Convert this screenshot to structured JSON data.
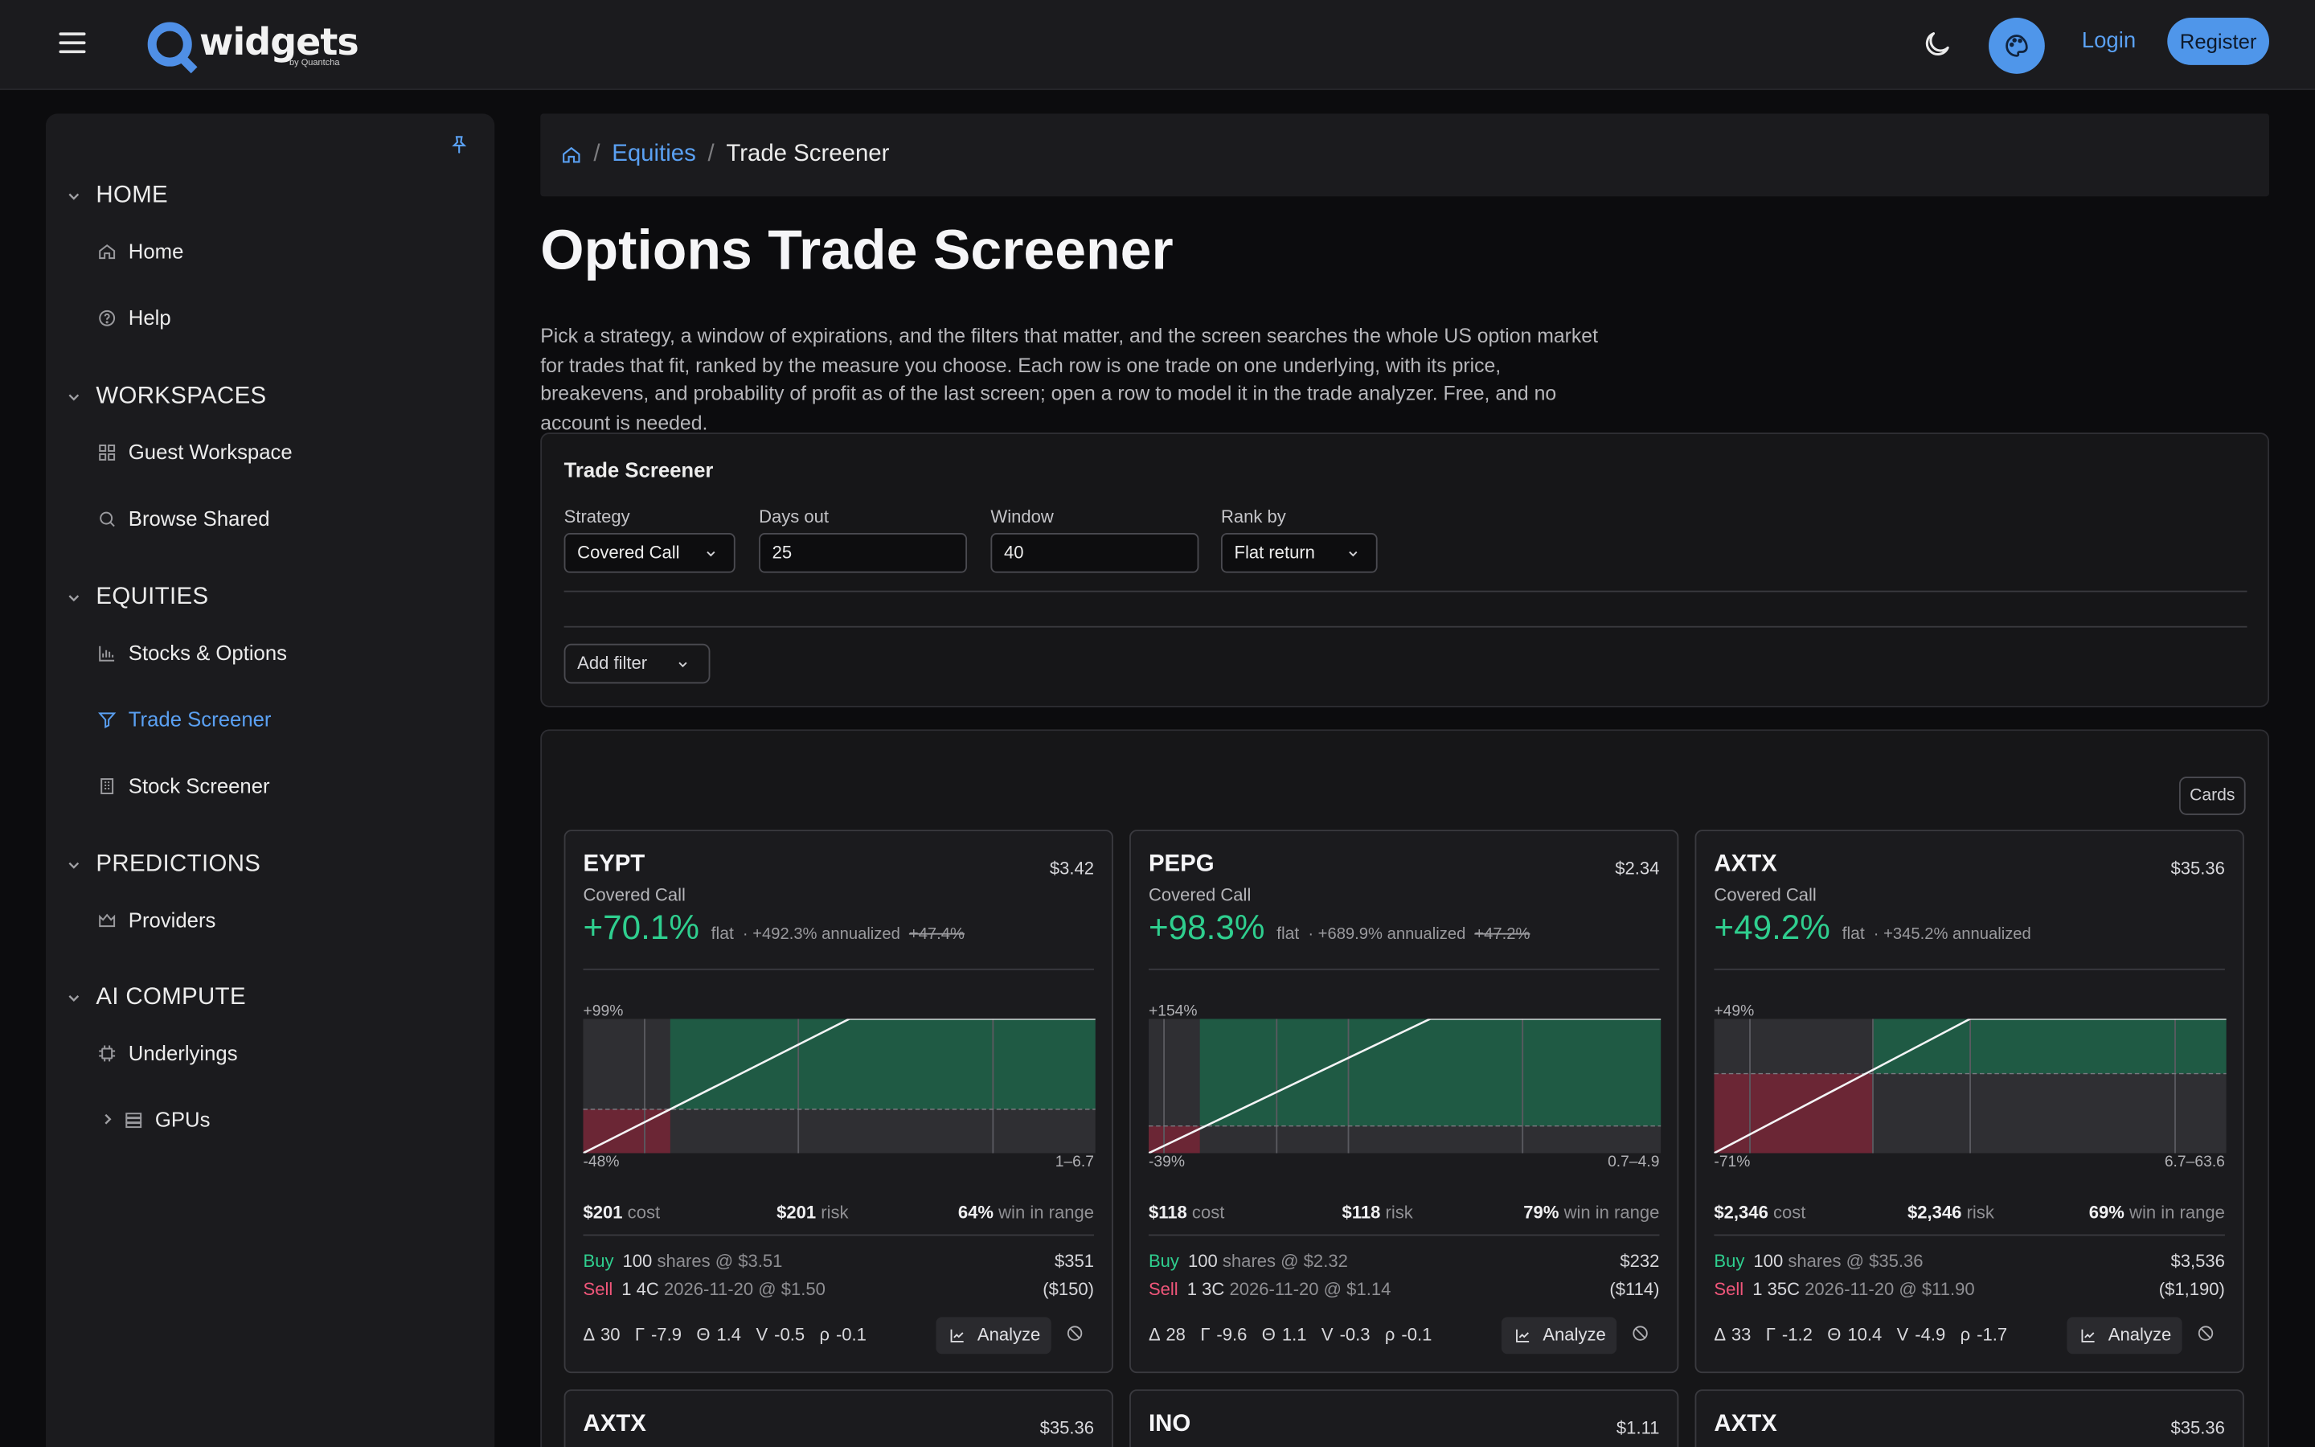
{
  "app": {
    "logo_text": "widgets",
    "logo_sub": "by Quantcha",
    "login_label": "Login",
    "register_label": "Register"
  },
  "sidebar": {
    "sections": [
      {
        "title": "HOME",
        "items": [
          {
            "label": "Home",
            "icon": "home-icon"
          },
          {
            "label": "Help",
            "icon": "help-icon"
          }
        ]
      },
      {
        "title": "WORKSPACES",
        "items": [
          {
            "label": "Guest Workspace",
            "icon": "grid-icon"
          },
          {
            "label": "Browse Shared",
            "icon": "search-icon"
          }
        ]
      },
      {
        "title": "EQUITIES",
        "items": [
          {
            "label": "Stocks & Options",
            "icon": "bar-chart-icon"
          },
          {
            "label": "Trade Screener",
            "icon": "filter-icon",
            "active": true
          },
          {
            "label": "Stock Screener",
            "icon": "building-icon"
          }
        ]
      },
      {
        "title": "PREDICTIONS",
        "items": [
          {
            "label": "Providers",
            "icon": "crown-icon"
          }
        ]
      },
      {
        "title": "AI COMPUTE",
        "items": [
          {
            "label": "Underlyings",
            "icon": "chip-icon"
          },
          {
            "label": "GPUs",
            "icon": "server-icon"
          }
        ]
      }
    ]
  },
  "breadcrumb": {
    "parent": "Equities",
    "current": "Trade Screener"
  },
  "page": {
    "title": "Options Trade Screener",
    "intro": "Pick a strategy, a window of expirations, and the filters that matter, and the screen searches the whole US option market for trades that fit, ranked by the measure you choose. Each row is one trade on one underlying, with its price, breakevens, and probability of profit as of the last screen; open a row to model it in the trade analyzer. Free, and no account is needed."
  },
  "screener": {
    "title": "Trade Screener",
    "strategy_label": "Strategy",
    "strategy_value": "Covered Call",
    "days_label": "Days out",
    "days_value": "25",
    "window_label": "Window",
    "window_value": "40",
    "rank_label": "Rank by",
    "rank_value": "Flat return",
    "add_filter": "Add filter"
  },
  "results": {
    "view_label": "Cards",
    "cards": [
      {
        "ticker": "EYPT",
        "price": "$3.42",
        "strategy": "Covered Call",
        "ret": "+70.1%",
        "flat": "flat",
        "ann": "· +492.3% annualized",
        "old": "+47.4%",
        "chart_top": "+99%",
        "chart_bot": "-48%",
        "chart_range": "1–6.7",
        "cost": "$201",
        "cost_lbl": "cost",
        "risk": "$201",
        "risk_lbl": "risk",
        "win": "64%",
        "win_lbl": "win in range",
        "buy": "Buy",
        "buy_qty": "100",
        "buy_desc": "shares @ $3.51",
        "buy_amt": "$351",
        "sell": "Sell",
        "sell_qty": "1 4C",
        "sell_desc": "2026-11-20 @ $1.50",
        "sell_amt": "($150)",
        "delta": "Δ 30",
        "gamma": "Γ -7.9",
        "theta": "Θ 1.4",
        "vega": "V -0.5",
        "rho": "ρ -0.1",
        "analyze": "Analyze",
        "payoff": {
          "max_return_pct": 99,
          "min_return_pct": -48,
          "x_min": 1,
          "x_max": 6.7,
          "breakeven_frac": 0.17,
          "cap_frac": 0.52,
          "stripes_frac": [
            0.12,
            0.42,
            0.8
          ]
        }
      },
      {
        "ticker": "PEPG",
        "price": "$2.34",
        "strategy": "Covered Call",
        "ret": "+98.3%",
        "flat": "flat",
        "ann": "· +689.9% annualized",
        "old": "+47.2%",
        "chart_top": "+154%",
        "chart_bot": "-39%",
        "chart_range": "0.7–4.9",
        "cost": "$118",
        "cost_lbl": "cost",
        "risk": "$118",
        "risk_lbl": "risk",
        "win": "79%",
        "win_lbl": "win in range",
        "buy": "Buy",
        "buy_qty": "100",
        "buy_desc": "shares @ $2.32",
        "buy_amt": "$232",
        "sell": "Sell",
        "sell_qty": "1 3C",
        "sell_desc": "2026-11-20 @ $1.14",
        "sell_amt": "($114)",
        "delta": "Δ 28",
        "gamma": "Γ -9.6",
        "theta": "Θ 1.1",
        "vega": "V -0.3",
        "rho": "ρ -0.1",
        "analyze": "Analyze",
        "payoff": {
          "max_return_pct": 154,
          "min_return_pct": -39,
          "x_min": 0.7,
          "x_max": 4.9,
          "breakeven_frac": 0.1,
          "cap_frac": 0.55,
          "stripes_frac": [
            0.03,
            0.25,
            0.39,
            0.73
          ]
        }
      },
      {
        "ticker": "AXTX",
        "price": "$35.36",
        "strategy": "Covered Call",
        "ret": "+49.2%",
        "flat": "flat",
        "ann": "· +345.2% annualized",
        "old": "",
        "chart_top": "+49%",
        "chart_bot": "-71%",
        "chart_range": "6.7–63.6",
        "cost": "$2,346",
        "cost_lbl": "cost",
        "risk": "$2,346",
        "risk_lbl": "risk",
        "win": "69%",
        "win_lbl": "win in range",
        "buy": "Buy",
        "buy_qty": "100",
        "buy_desc": "shares @ $35.36",
        "buy_amt": "$3,536",
        "sell": "Sell",
        "sell_qty": "1 35C",
        "sell_desc": "2026-11-20 @ $11.90",
        "sell_amt": "($1,190)",
        "delta": "Δ 33",
        "gamma": "Γ -1.2",
        "theta": "Θ 10.4",
        "vega": "V -4.9",
        "rho": "ρ -1.7",
        "analyze": "Analyze",
        "payoff": {
          "max_return_pct": 49,
          "min_return_pct": -71,
          "x_min": 6.7,
          "x_max": 63.6,
          "breakeven_frac": 0.31,
          "cap_frac": 0.5,
          "stripes_frac": [
            0.07,
            0.31,
            0.5,
            0.9
          ]
        }
      }
    ],
    "partial_cards": [
      {
        "ticker": "AXTX",
        "price": "$35.36"
      },
      {
        "ticker": "INO",
        "price": "$1.11"
      },
      {
        "ticker": "AXTX",
        "price": "$35.36"
      }
    ]
  },
  "colors": {
    "accent": "#4f96ea",
    "positive": "#2fcf8f",
    "negative": "#f0567a",
    "profit_fill": "#1f5a44",
    "loss_fill": "#6b2635"
  }
}
